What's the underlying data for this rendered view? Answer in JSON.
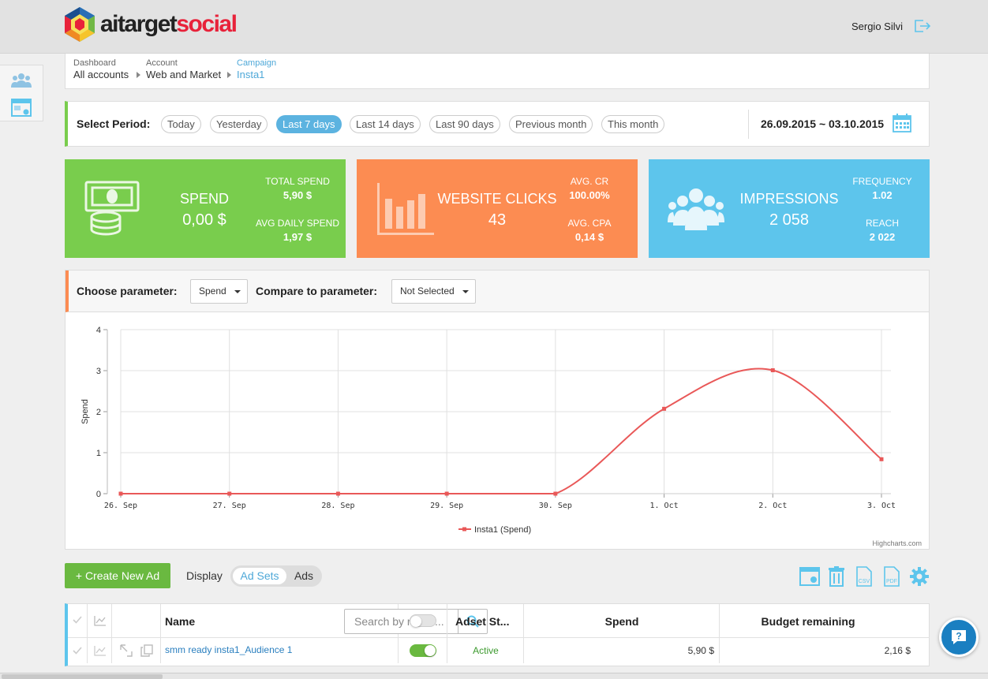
{
  "brand": {
    "name_part1": "aitarget",
    "name_part2": "social"
  },
  "user": {
    "name": "Sergio Silvi"
  },
  "breadcrumb": [
    {
      "key": "Dashboard",
      "value": "All accounts"
    },
    {
      "key": "Account",
      "value": "Web and Market"
    },
    {
      "key": "Campaign",
      "value": "Insta1"
    }
  ],
  "period": {
    "label": "Select Period:",
    "options": [
      "Today",
      "Yesterday",
      "Last 7 days",
      "Last 14 days",
      "Last 90 days",
      "Previous month",
      "This month"
    ],
    "selected": "Last 7 days",
    "date_range": "26.09.2015 ~ 03.10.2015"
  },
  "cards": {
    "spend": {
      "label": "SPEND",
      "value": "0,00 $",
      "sub1_label": "TOTAL SPEND",
      "sub1_value": "5,90 $",
      "sub2_label": "AVG DAILY SPEND",
      "sub2_value": "1,97 $",
      "color": "#79cd4d"
    },
    "clicks": {
      "label": "WEBSITE CLICKS",
      "value": "43",
      "sub1_label": "AVG. CR",
      "sub1_value": "100.00%",
      "sub2_label": "AVG. CPA",
      "sub2_value": "0,14 $",
      "color": "#fc8c52"
    },
    "impressions": {
      "label": "IMPRESSIONS",
      "value": "2 058",
      "sub1_label": "FREQUENCY",
      "sub1_value": "1.02",
      "sub2_label": "REACH",
      "sub2_value": "2 022",
      "color": "#5dc5ec"
    }
  },
  "params": {
    "choose_label": "Choose parameter:",
    "choose_value": "Spend",
    "compare_label": "Compare to parameter:",
    "compare_value": "Not Selected"
  },
  "chart_data": {
    "type": "line",
    "title": "",
    "xlabel": "",
    "ylabel": "Spend",
    "categories": [
      "26. Sep",
      "27. Sep",
      "28. Sep",
      "29. Sep",
      "30. Sep",
      "1. Oct",
      "2. Oct",
      "3. Oct"
    ],
    "ylim": [
      0,
      4
    ],
    "yticks": [
      0,
      1,
      2,
      3,
      4
    ],
    "grid": true,
    "legend_position": "bottom-center",
    "credits": "Highcharts.com",
    "series": [
      {
        "name": "Insta1 (Spend)",
        "values": [
          0,
          0,
          0,
          0,
          0,
          2.07,
          3.01,
          0.84
        ],
        "color": "#e95858"
      }
    ]
  },
  "toolbar": {
    "create_label": "+ Create New Ad",
    "display_label": "Display",
    "display_options": [
      "Ad Sets",
      "Ads"
    ],
    "display_selected": "Ad Sets",
    "csv_label": "CSV",
    "pdf_label": "PDF"
  },
  "table": {
    "headers": {
      "name": "Name",
      "status": "Adset St...",
      "spend": "Spend",
      "budget": "Budget remaining"
    },
    "search_placeholder": "Search by name...",
    "rows": [
      {
        "name": "smm ready insta1_Audience 1",
        "status": "Active",
        "spend": "5,90 $",
        "budget": "2,16 $"
      }
    ]
  }
}
